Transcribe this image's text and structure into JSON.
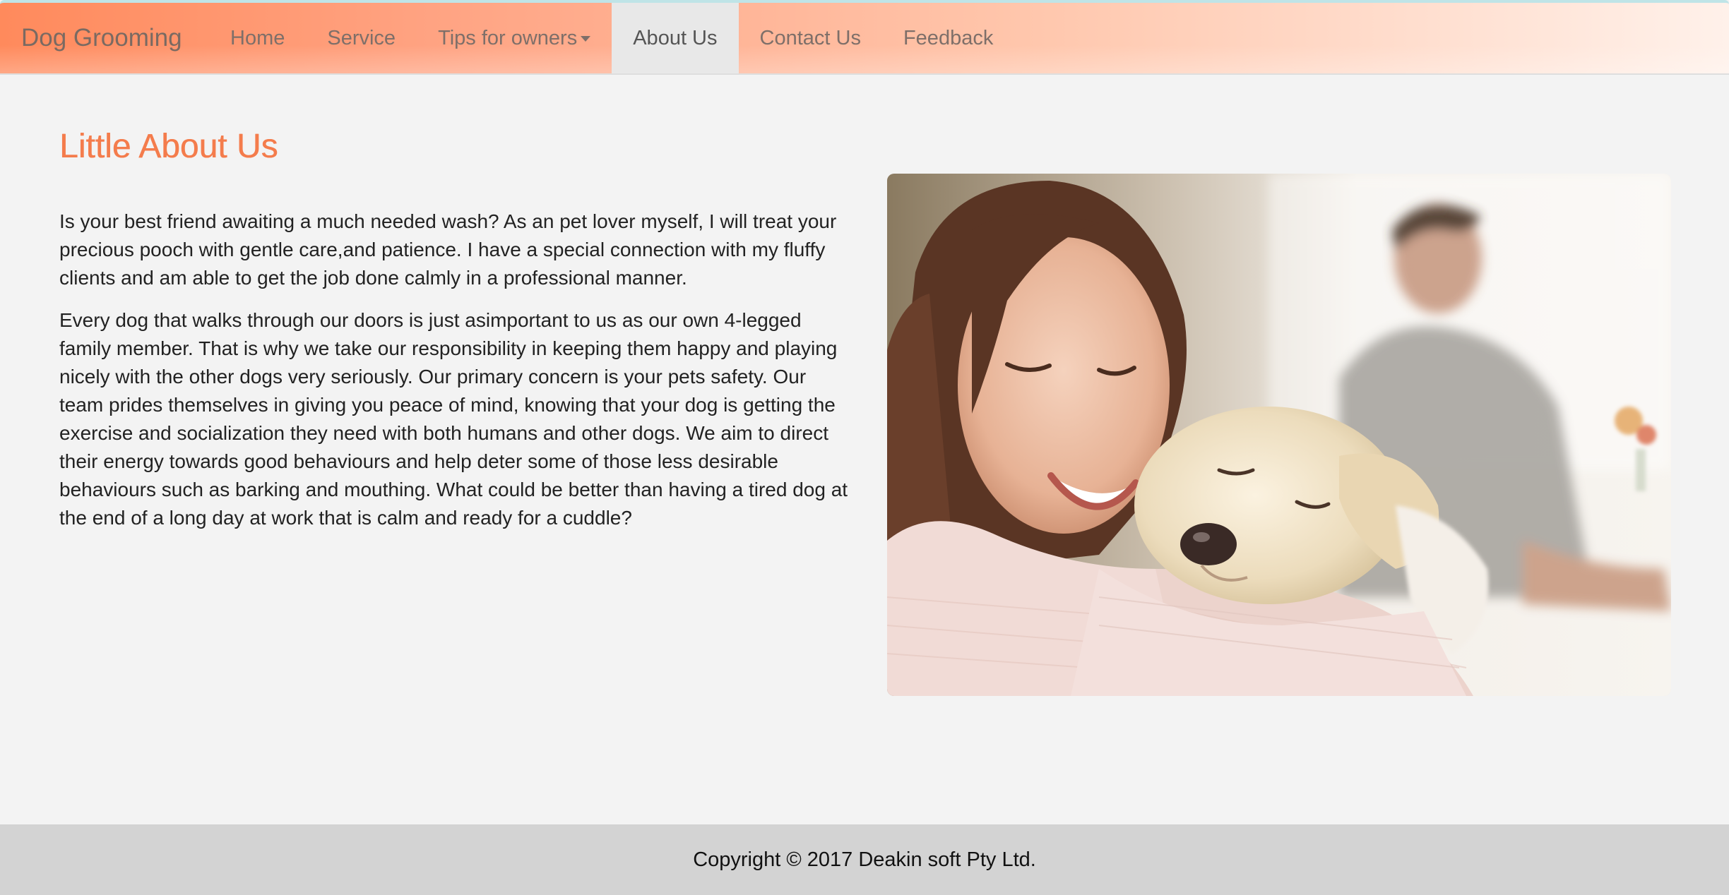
{
  "navbar": {
    "brand": "Dog Grooming",
    "items": [
      {
        "label": "Home",
        "active": false
      },
      {
        "label": "Service",
        "active": false
      },
      {
        "label": "Tips for owners",
        "active": false,
        "dropdown": true
      },
      {
        "label": "About Us",
        "active": true
      },
      {
        "label": "Contact Us",
        "active": false
      },
      {
        "label": "Feedback",
        "active": false
      }
    ]
  },
  "main": {
    "title": "Little About Us",
    "paragraphs": [
      "Is your best friend awaiting a much needed wash? As an pet lover myself, I will treat your precious pooch with gentle care,and patience. I have a special connection with my fluffy clients and am able to get the job done calmly in a professional manner.",
      "Every dog that walks through our doors is just asimportant to us as our own 4-legged family member. That is why we take our responsibility in keeping them happy and playing nicely with the other dogs very seriously. Our primary concern is your pets safety. Our team prides themselves in giving you peace of mind, knowing that your dog is getting the exercise and socialization they need with both humans and other dogs. We aim to direct their energy towards good behaviours and help deter some of those less desirable behaviours such as barking and mouthing. What could be better than having a tired dog at the end of a long day at work that is calm and ready for a cuddle?"
    ]
  },
  "footer": {
    "copyright": "Copyright © 2017 Deakin soft Pty Ltd."
  },
  "colors": {
    "accent": "#f47c4c",
    "nav_gradient_start": "#ff8a5c",
    "footer_bg": "#d3d3d3",
    "page_bg": "#f3f3f3"
  }
}
